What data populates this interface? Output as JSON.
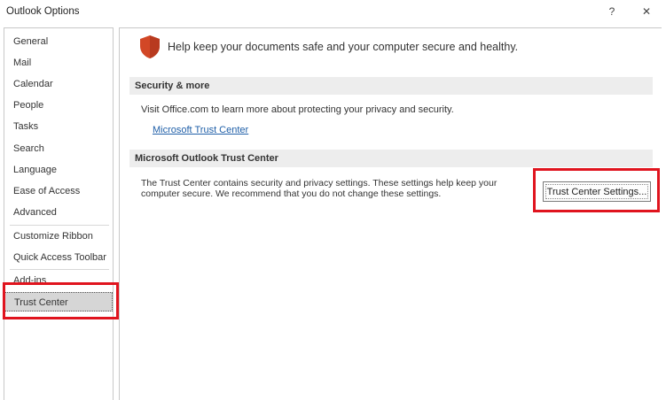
{
  "window": {
    "title": "Outlook Options",
    "help_label": "?",
    "close_label": "✕"
  },
  "sidebar": {
    "items": [
      {
        "label": "General"
      },
      {
        "label": "Mail"
      },
      {
        "label": "Calendar"
      },
      {
        "label": "People"
      },
      {
        "label": "Tasks"
      },
      {
        "label": "Search"
      },
      {
        "label": "Language"
      },
      {
        "label": "Ease of Access"
      },
      {
        "label": "Advanced"
      },
      {
        "label": "Customize Ribbon"
      },
      {
        "label": "Quick Access Toolbar"
      },
      {
        "label": "Add-ins"
      },
      {
        "label": "Trust Center"
      }
    ],
    "selected": "Trust Center"
  },
  "main": {
    "header": "Help keep your documents safe and your computer secure and healthy.",
    "security_section": {
      "heading": "Security & more",
      "text": "Visit Office.com to learn more about protecting your privacy and security.",
      "link": "Microsoft Trust Center"
    },
    "trust_center_section": {
      "heading": "Microsoft Outlook Trust Center",
      "text": "The Trust Center contains security and privacy settings. These settings help keep your computer secure. We recommend that you do not change these settings.",
      "button_label": "Trust Center Settings..."
    }
  },
  "colors": {
    "highlight_box": "#e0141e",
    "shield": "#d24726",
    "link": "#1f5fa8",
    "selected_bg": "#d6d6d6"
  }
}
